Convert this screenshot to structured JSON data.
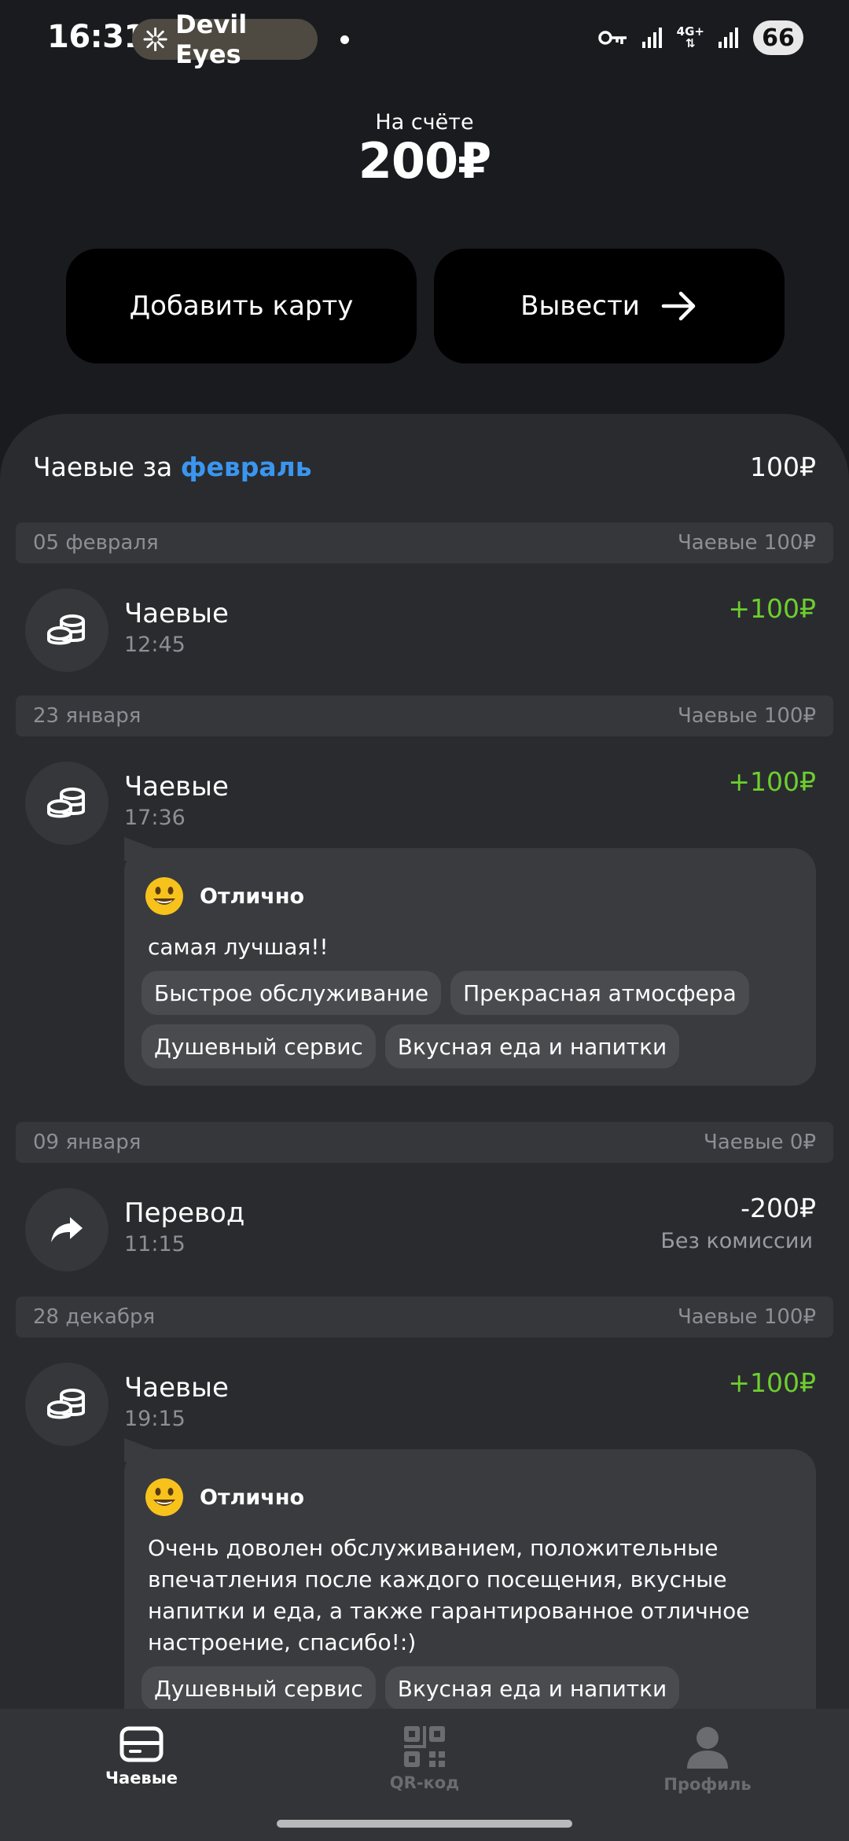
{
  "status_bar": {
    "time": "16:31",
    "now_playing": "Devil Eyes",
    "network": "4G+",
    "battery": "66"
  },
  "balance": {
    "label": "На счёте",
    "amount": "200₽"
  },
  "actions": {
    "add_card": "Добавить карту",
    "withdraw": "Вывести"
  },
  "summary": {
    "prefix": "Чаевые за",
    "month": "февраль",
    "total": "100₽"
  },
  "groups": [
    {
      "date": "05 февраля",
      "sum": "Чаевые 100₽",
      "items": [
        {
          "title": "Чаевые",
          "time": "12:45",
          "amount": "+100₽"
        }
      ]
    },
    {
      "date": "23 января",
      "sum": "Чаевые 100₽",
      "items": [
        {
          "title": "Чаевые",
          "time": "17:36",
          "amount": "+100₽",
          "review": {
            "rating": "Отлично",
            "text": "самая лучшая!!",
            "tags": [
              "Быстрое обслуживание",
              "Прекрасная атмосфера",
              "Душевный сервис",
              "Вкусная еда и напитки"
            ]
          }
        }
      ]
    },
    {
      "date": "09 января",
      "sum": "Чаевые 0₽",
      "items": [
        {
          "title": "Перевод",
          "time": "11:15",
          "amount": "-200₽",
          "note": "Без комиссии"
        }
      ]
    },
    {
      "date": "28 декабря",
      "sum": "Чаевые 100₽",
      "items": [
        {
          "title": "Чаевые",
          "time": "19:15",
          "amount": "+100₽",
          "review": {
            "rating": "Отлично",
            "text": "Очень доволен обслуживанием,  положительные впечатления после каждого посещения, вкусные напитки и еда, а также гарантированное отличное настроение, спасибо!:)",
            "tags": [
              "Душевный сервис",
              "Вкусная еда и напитки"
            ]
          }
        }
      ]
    }
  ],
  "nav": {
    "tips": "Чаевые",
    "qr": "QR-код",
    "profile": "Профиль"
  },
  "colors": {
    "accent_link": "#3a96ef",
    "positive": "#6dcf2f",
    "background": "#1a1b1f",
    "sheet": "#2a2b2f"
  }
}
